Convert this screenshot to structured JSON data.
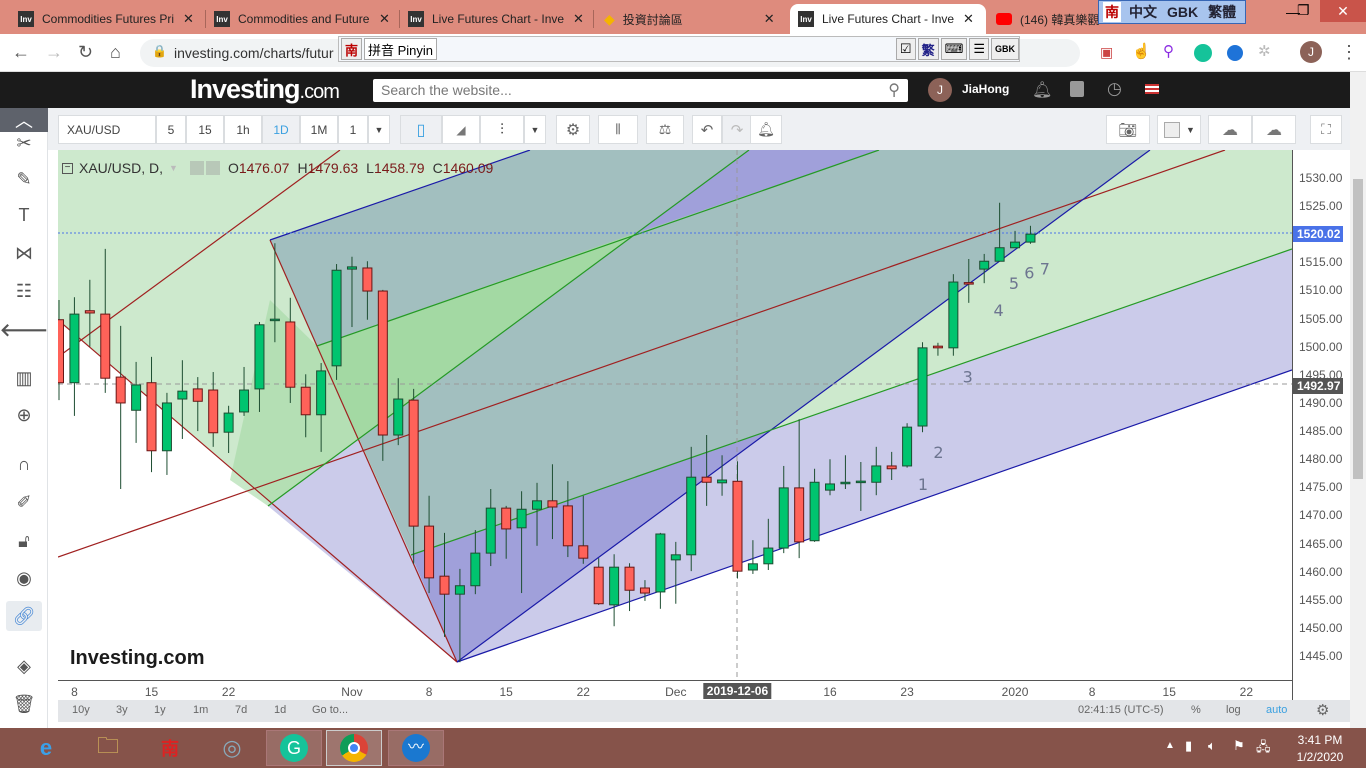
{
  "browser": {
    "tabs": [
      {
        "label": "Commodities Futures Pri",
        "icon": "Inv"
      },
      {
        "label": "Commodities and Future",
        "icon": "Inv"
      },
      {
        "label": "Live Futures Chart - Inve",
        "icon": "Inv"
      },
      {
        "label": "投資討論區",
        "icon": "diamond"
      },
      {
        "label": "Live Futures Chart - Inve",
        "icon": "Inv",
        "active": true
      },
      {
        "label": "(146) 韓真樂觀",
        "icon": "youtube"
      }
    ],
    "close": "✕",
    "url": "investing.com/charts/futur",
    "ime": {
      "logo": "南",
      "mode": "拼音 Pinyin",
      "trad": "繁",
      "gbk": "GBK",
      "top_logo": "南",
      "top_lang": "中文",
      "top_gbk": "GBK",
      "top_trad": "繁體"
    },
    "profile_initial": "J"
  },
  "site": {
    "logo": "Investing",
    "logo_suffix": ".com",
    "search_placeholder": "Search the website...",
    "avatar": "J",
    "username": "JiaHong"
  },
  "toolbar": {
    "symbol": "XAU/USD",
    "intervals": [
      "5",
      "15",
      "1h",
      "1D",
      "1M",
      "1"
    ],
    "active_interval": "1D"
  },
  "legend": {
    "title": "XAU/USD, D,",
    "o_label": "O",
    "o": "1476.07",
    "h_label": "H",
    "h": "1479.63",
    "l_label": "L",
    "l": "1458.79",
    "c_label": "C",
    "c": "1460.09"
  },
  "chart_data": {
    "type": "candlestick",
    "symbol": "XAU/USD",
    "interval": "D",
    "ylim": [
      1441,
      1534
    ],
    "y_ticks": [
      "1530.00",
      "1525.00",
      "1520.00",
      "1515.00",
      "1510.00",
      "1505.00",
      "1500.00",
      "1495.00",
      "1490.00",
      "1485.00",
      "1480.00",
      "1475.00",
      "1470.00",
      "1465.00",
      "1460.00",
      "1455.00",
      "1450.00",
      "1445.00"
    ],
    "last_price": "1520.02",
    "marker_price": "1492.97",
    "crosshair_date": "2019-12-06",
    "x_ticks": [
      {
        "label": "8",
        "idx": 1
      },
      {
        "label": "15",
        "idx": 6
      },
      {
        "label": "22",
        "idx": 11
      },
      {
        "label": "Nov",
        "idx": 19
      },
      {
        "label": "8",
        "idx": 24
      },
      {
        "label": "15",
        "idx": 29
      },
      {
        "label": "22",
        "idx": 34
      },
      {
        "label": "Dec",
        "idx": 40
      },
      {
        "label": "16",
        "idx": 50
      },
      {
        "label": "23",
        "idx": 55
      },
      {
        "label": "2020",
        "idx": 62
      },
      {
        "label": "8",
        "idx": 67
      },
      {
        "label": "15",
        "idx": 72
      },
      {
        "label": "22",
        "idx": 77
      }
    ],
    "wave_labels": [
      {
        "t": "1",
        "idx": 55.7,
        "p": 1474.5
      },
      {
        "t": "2",
        "idx": 56.7,
        "p": 1480.2
      },
      {
        "t": "3",
        "idx": 58.6,
        "p": 1493.6
      },
      {
        "t": "4",
        "idx": 60.6,
        "p": 1505.5
      },
      {
        "t": "5",
        "idx": 61.6,
        "p": 1510.3
      },
      {
        "t": "6",
        "idx": 62.6,
        "p": 1512.1
      },
      {
        "t": "7",
        "idx": 63.6,
        "p": 1512.8
      }
    ],
    "candles": [
      [
        "2019-10-07",
        1504.8,
        1508.3,
        1490.5,
        1493.6
      ],
      [
        "2019-10-08",
        1493.6,
        1508.8,
        1487.7,
        1505.8
      ],
      [
        "2019-10-09",
        1506.4,
        1511.9,
        1500.0,
        1506.0
      ],
      [
        "2019-10-10",
        1505.8,
        1517.4,
        1491.8,
        1494.4
      ],
      [
        "2019-10-11",
        1494.6,
        1503.7,
        1474.7,
        1490.0
      ],
      [
        "2019-10-14",
        1488.7,
        1497.3,
        1482.9,
        1493.2
      ],
      [
        "2019-10-15",
        1493.6,
        1498.2,
        1477.7,
        1481.5
      ],
      [
        "2019-10-16",
        1481.5,
        1491.8,
        1477.2,
        1490.0
      ],
      [
        "2019-10-17",
        1490.7,
        1497.6,
        1483.6,
        1492.1
      ],
      [
        "2019-10-18",
        1492.5,
        1494.6,
        1485.0,
        1490.3
      ],
      [
        "2019-10-21",
        1492.3,
        1495.5,
        1482.2,
        1484.7
      ],
      [
        "2019-10-22",
        1484.8,
        1489.5,
        1481.1,
        1488.2
      ],
      [
        "2019-10-23",
        1488.4,
        1496.4,
        1487.7,
        1492.3
      ],
      [
        "2019-10-24",
        1492.5,
        1504.4,
        1488.4,
        1503.9
      ],
      [
        "2019-10-25",
        1504.7,
        1518.4,
        1500.8,
        1504.9
      ],
      [
        "2019-10-28",
        1504.4,
        1508.7,
        1490.0,
        1492.8
      ],
      [
        "2019-10-29",
        1492.8,
        1495.1,
        1483.9,
        1487.9
      ],
      [
        "2019-10-30",
        1487.9,
        1497.1,
        1481.3,
        1495.7
      ],
      [
        "2019-10-31",
        1496.6,
        1514.7,
        1494.1,
        1513.6
      ],
      [
        "2019-11-01",
        1513.8,
        1516.0,
        1503.5,
        1514.2
      ],
      [
        "2019-11-04",
        1514.0,
        1515.2,
        1504.8,
        1509.9
      ],
      [
        "2019-11-05",
        1509.9,
        1510.1,
        1479.7,
        1484.3
      ],
      [
        "2019-11-06",
        1484.3,
        1494.4,
        1482.5,
        1490.7
      ],
      [
        "2019-11-07",
        1490.5,
        1492.5,
        1461.4,
        1468.1
      ],
      [
        "2019-11-08",
        1468.1,
        1473.5,
        1456.2,
        1458.9
      ],
      [
        "2019-11-11",
        1459.2,
        1466.9,
        1448.4,
        1456.0
      ],
      [
        "2019-11-12",
        1456.0,
        1460.5,
        1443.9,
        1457.5
      ],
      [
        "2019-11-13",
        1457.5,
        1467.4,
        1456.0,
        1463.3
      ],
      [
        "2019-11-14",
        1463.3,
        1474.7,
        1461.0,
        1471.3
      ],
      [
        "2019-11-15",
        1471.3,
        1471.7,
        1462.3,
        1467.6
      ],
      [
        "2019-11-18",
        1467.8,
        1474.3,
        1456.2,
        1471.1
      ],
      [
        "2019-11-19",
        1471.1,
        1475.8,
        1464.6,
        1472.6
      ],
      [
        "2019-11-20",
        1472.6,
        1479.1,
        1465.8,
        1471.5
      ],
      [
        "2019-11-21",
        1471.7,
        1476.1,
        1462.6,
        1464.6
      ],
      [
        "2019-11-22",
        1464.6,
        1473.5,
        1461.4,
        1462.4
      ],
      [
        "2019-11-25",
        1460.8,
        1462.4,
        1454.1,
        1454.3
      ],
      [
        "2019-11-26",
        1454.1,
        1463.1,
        1450.3,
        1460.8
      ],
      [
        "2019-11-27",
        1460.8,
        1461.5,
        1453.0,
        1456.7
      ],
      [
        "2019-11-28",
        1457.1,
        1458.5,
        1454.8,
        1456.2
      ],
      [
        "2019-11-29",
        1456.4,
        1466.9,
        1453.4,
        1466.7
      ],
      [
        "2019-12-02",
        1462.1,
        1465.3,
        1454.3,
        1463.0
      ],
      [
        "2019-12-03",
        1463.0,
        1482.2,
        1460.1,
        1476.8
      ],
      [
        "2019-12-04",
        1476.8,
        1484.3,
        1471.7,
        1475.9
      ],
      [
        "2019-12-05",
        1475.8,
        1480.7,
        1473.5,
        1476.3
      ],
      [
        "2019-12-06",
        1476.07,
        1479.63,
        1458.79,
        1460.09
      ],
      [
        "2019-12-09",
        1460.3,
        1465.6,
        1459.6,
        1461.4
      ],
      [
        "2019-12-10",
        1461.4,
        1469.4,
        1460.3,
        1464.2
      ],
      [
        "2019-12-11",
        1464.2,
        1478.8,
        1463.3,
        1474.9
      ],
      [
        "2019-12-12",
        1474.9,
        1487.1,
        1462.4,
        1465.3
      ],
      [
        "2019-12-13",
        1465.5,
        1478.3,
        1465.3,
        1475.9
      ],
      [
        "2019-12-16",
        1474.5,
        1480.0,
        1473.6,
        1475.6
      ],
      [
        "2019-12-17",
        1475.8,
        1480.7,
        1474.7,
        1475.9
      ],
      [
        "2019-12-18",
        1476.0,
        1479.5,
        1470.8,
        1476.1
      ],
      [
        "2019-12-19",
        1475.9,
        1482.2,
        1473.6,
        1478.8
      ],
      [
        "2019-12-20",
        1478.8,
        1481.3,
        1476.3,
        1478.3
      ],
      [
        "2019-12-23",
        1478.8,
        1486.4,
        1478.5,
        1485.7
      ],
      [
        "2019-12-24",
        1485.9,
        1500.8,
        1484.8,
        1499.8
      ],
      [
        "2019-12-25",
        1500.1,
        1500.7,
        1498.4,
        1499.8
      ],
      [
        "2019-12-26",
        1499.8,
        1512.9,
        1498.4,
        1511.5
      ],
      [
        "2019-12-27",
        1511.4,
        1515.6,
        1507.8,
        1511.3
      ],
      [
        "2019-12-30",
        1513.8,
        1516.5,
        1511.3,
        1515.2
      ],
      [
        "2019-12-31",
        1515.2,
        1525.6,
        1515.2,
        1517.6
      ],
      [
        "2020-01-01",
        1517.6,
        1520.6,
        1517.6,
        1518.6
      ],
      [
        "2020-01-02",
        1518.6,
        1521.5,
        1518.3,
        1520.02
      ]
    ],
    "colors": {
      "up": "#00c46f",
      "down": "#ff6259",
      "last_price": "#4a72e8",
      "marker": "#555555"
    }
  },
  "watermark": "Investing.com",
  "bottom": {
    "ranges": [
      "10y",
      "3y",
      "1y",
      "1m",
      "7d",
      "1d"
    ],
    "goto": "Go to...",
    "time": "02:41:15 (UTC-5)",
    "percent": "%",
    "log": "log",
    "auto": "auto"
  },
  "taskbar": {
    "time": "3:41 PM",
    "date": "1/2/2020"
  }
}
